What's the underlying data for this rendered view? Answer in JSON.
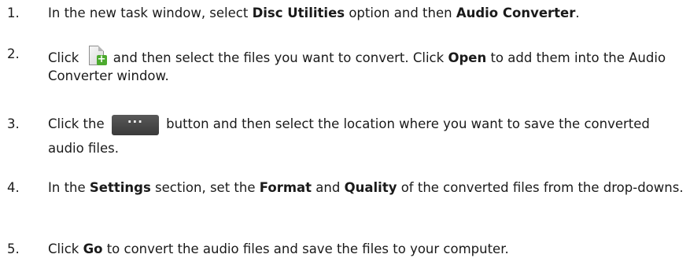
{
  "steps": [
    {
      "number": "1.",
      "t1": "In the new task window, select ",
      "b1": "Disc Utilities",
      "t2": " option and then ",
      "b2": "Audio Converter",
      "t3": "."
    },
    {
      "number": "2.",
      "t1": "Click ",
      "icon": "add-file-icon",
      "t2": " and then select the files you want to convert. Click ",
      "b1": "Open",
      "t3": " to add them into the Audio Converter window."
    },
    {
      "number": "3.",
      "t1": "Click the ",
      "icon": "browse-button-icon",
      "icon_label": "···",
      "t2": " button and then select the location where you want to save the converted audio files."
    },
    {
      "number": "4.",
      "t1": "In the ",
      "b1": "Settings",
      "t2": " section, set the ",
      "b2": "Format",
      "t3": " and ",
      "b3": "Quality",
      "t4": " of the converted files from the drop-downs."
    },
    {
      "number": "5.",
      "t1": "Click ",
      "b1": "Go",
      "t2": " to convert the audio files and save the files to your computer."
    }
  ],
  "colors": {
    "text": "#1a1a1a",
    "browse_button": "#4a4a4a",
    "plus_green": "#4caa2e"
  }
}
